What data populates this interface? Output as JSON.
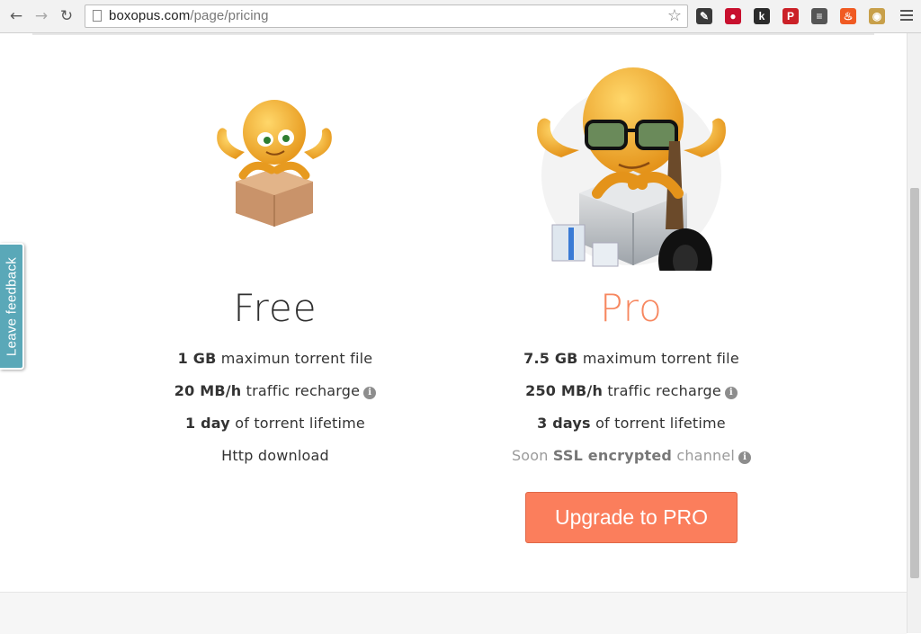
{
  "browser": {
    "url_host": "boxopus.com",
    "url_path": "/page/pricing",
    "back_icon": "back-arrow-icon",
    "forward_icon": "forward-arrow-icon",
    "reload_icon": "reload-icon",
    "bookmark_icon": "star-icon",
    "extensions": [
      {
        "name": "evernote-icon",
        "glyph": "✎",
        "bg": "#3a3a3a"
      },
      {
        "name": "ublock-icon",
        "glyph": "●",
        "bg": "#c8102e"
      },
      {
        "name": "k-extension-icon",
        "glyph": "k",
        "bg": "#2b2b2b"
      },
      {
        "name": "pinterest-icon",
        "glyph": "P",
        "bg": "#cb2027"
      },
      {
        "name": "reader-icon",
        "glyph": "≡",
        "bg": "#555555"
      },
      {
        "name": "fire-icon",
        "glyph": "♨",
        "bg": "#f05a22"
      },
      {
        "name": "cookie-icon",
        "glyph": "◉",
        "bg": "#c8a04a"
      }
    ],
    "menu_icon": "hamburger-menu-icon"
  },
  "feedback": {
    "label": "Leave feedback"
  },
  "plans": {
    "free": {
      "title": "Free",
      "title_color": "#2f2f2f",
      "features": [
        {
          "bold": "1 GB",
          "text": " maximun torrent file",
          "info": false
        },
        {
          "bold": "20 MB/h",
          "text": " traffic recharge",
          "info": true
        },
        {
          "bold": "1 day",
          "text": " of torrent lifetime",
          "info": false
        },
        {
          "bold": "",
          "text": "Http download",
          "info": false
        }
      ]
    },
    "pro": {
      "title": "Pro",
      "title_color": "#f7875f",
      "features": [
        {
          "bold": "7.5 GB",
          "text": " maximum torrent file",
          "info": false
        },
        {
          "bold": "250 MB/h",
          "text": " traffic recharge",
          "info": true
        },
        {
          "bold": "3 days",
          "text": " of torrent lifetime",
          "info": false
        }
      ],
      "soon": {
        "prefix": "Soon ",
        "bold": "SSL encrypted",
        "suffix": " channel",
        "info": true
      },
      "upgrade_label": "Upgrade to PRO"
    }
  },
  "colors": {
    "accent": "#fb7e5c",
    "feedback": "#5aa8b8"
  }
}
